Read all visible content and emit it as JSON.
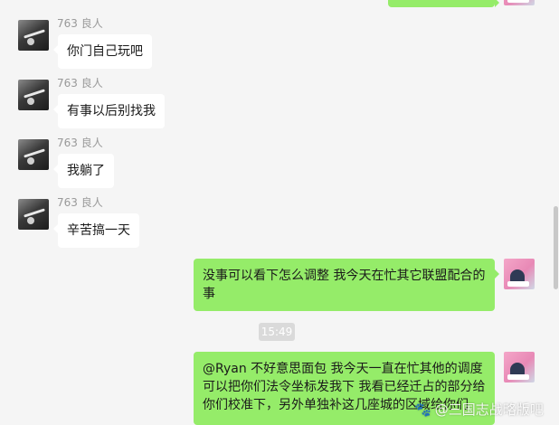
{
  "chat": {
    "messages": [
      {
        "sender": "763 良人",
        "text": "你门自己玩吧"
      },
      {
        "sender": "763 良人",
        "text": "有事以后别找我"
      },
      {
        "sender": "763 良人",
        "text": "我躺了"
      },
      {
        "sender": "763 良人",
        "text": "辛苦搞一天"
      },
      {
        "text": "没事可以看下怎么调整 我今天在忙其它联盟配合的事"
      },
      {
        "text": "@Ryan 不好意思面包 我今天一直在忙其他的调度 可以把你们法令坐标发我下 我看已经迁占的部分给你们校准下，另外单独补这几座城的区域给你们"
      }
    ],
    "timestamp": "15:49"
  },
  "watermark": {
    "text": "@三国志战略版吧"
  },
  "colors": {
    "bubble_out": "#95ec69",
    "bubble_in": "#ffffff",
    "background": "#f5f5f5"
  }
}
